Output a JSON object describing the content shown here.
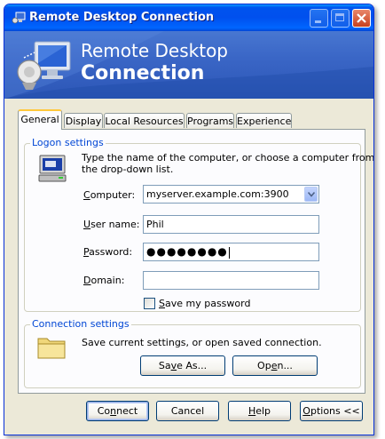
{
  "window": {
    "title": "Remote Desktop Connection",
    "colors": {
      "titlebar": "#0053ee",
      "banner": "#3a66c6",
      "face": "#ece9d8",
      "group_label": "#0046d5"
    }
  },
  "banner": {
    "line1": "Remote Desktop",
    "line2": "Connection"
  },
  "tabs": [
    {
      "label": "General",
      "active": true
    },
    {
      "label": "Display",
      "active": false
    },
    {
      "label": "Local Resources",
      "active": false
    },
    {
      "label": "Programs",
      "active": false
    },
    {
      "label": "Experience",
      "active": false
    }
  ],
  "logon": {
    "group_label": "Logon settings",
    "description_line1": "Type the name of the computer, or choose a computer from",
    "description_line2": "the drop-down list.",
    "computer": {
      "label_underlined": "C",
      "label_rest": "omputer:",
      "value": "myserver.example.com:3900"
    },
    "username": {
      "label_underlined": "U",
      "label_rest": "ser name:",
      "value": "Phil"
    },
    "password": {
      "label_underlined": "P",
      "label_rest": "assword:",
      "value": "●●●●●●●●"
    },
    "domain": {
      "label_underlined": "D",
      "label_rest": "omain:",
      "value": ""
    },
    "save_password": {
      "label_underlined": "S",
      "label_rest": "ave my password",
      "checked": false
    }
  },
  "connection": {
    "group_label": "Connection settings",
    "description": "Save current settings, or open saved connection.",
    "save_as": {
      "label_pre": "Sa",
      "label_underlined": "v",
      "label_post": "e As..."
    },
    "open": {
      "label_pre": "Op",
      "label_underlined": "e",
      "label_post": "n..."
    }
  },
  "buttons": {
    "connect": {
      "label_pre": "Co",
      "label_underlined": "n",
      "label_post": "nect"
    },
    "cancel": {
      "label": "Cancel"
    },
    "help": {
      "label_pre": "",
      "label_underlined": "H",
      "label_post": "elp"
    },
    "options": {
      "label_pre": "",
      "label_underlined": "O",
      "label_post": "ptions <<"
    }
  },
  "icons": [
    "remote-desktop-icon",
    "minimize-icon",
    "maximize-icon",
    "close-icon",
    "computer-icon",
    "folder-icon",
    "chevron-down-icon"
  ]
}
